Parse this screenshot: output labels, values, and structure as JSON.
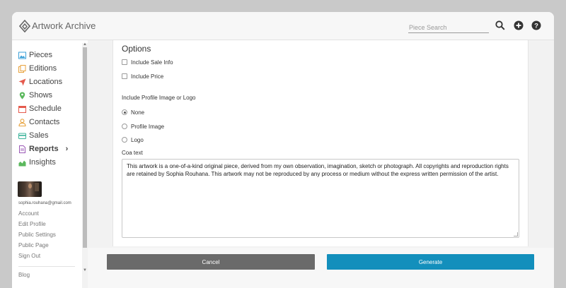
{
  "app": {
    "title": "Artwork Archive"
  },
  "search": {
    "placeholder": "Piece Search"
  },
  "icons": {
    "search": "search-icon",
    "add": "plus-circle-icon",
    "help": "question-circle-icon",
    "logo": "artwork-archive-logo-icon"
  },
  "nav": {
    "pieces": "Pieces",
    "editions": "Editions",
    "locations": "Locations",
    "shows": "Shows",
    "schedule": "Schedule",
    "contacts": "Contacts",
    "sales": "Sales",
    "reports": "Reports",
    "insights": "Insights"
  },
  "user": {
    "email": "sophia.rouhana@gmail.com",
    "links": {
      "account": "Account",
      "edit_profile": "Edit Profile",
      "public_settings": "Public Settings",
      "public_page": "Public Page",
      "sign_out": "Sign Out"
    },
    "blog": "Blog"
  },
  "options": {
    "title": "Options",
    "include_sale_info": {
      "label": "Include Sale Info",
      "checked": false
    },
    "include_price": {
      "label": "Include Price",
      "checked": false
    },
    "profile_image_label": "Include Profile Image or Logo",
    "radios": {
      "none": "None",
      "profile_image": "Profile Image",
      "logo": "Logo"
    },
    "selected_radio": "None",
    "coa_label": "Coa text",
    "coa_text": "This artwork is a one-of-a-kind original piece, derived from my own observation, imagination, sketch or photograph. All copyrights and reproduction rights are retained by Sophia Rouhana. This artwork may not be reproduced by any process or medium without the express written permission of the artist."
  },
  "actions": {
    "cancel": "Cancel",
    "generate": "Generate"
  },
  "colors": {
    "accent": "#138fbc",
    "cancel": "#6a6a6a",
    "active_nav": "#333333"
  }
}
